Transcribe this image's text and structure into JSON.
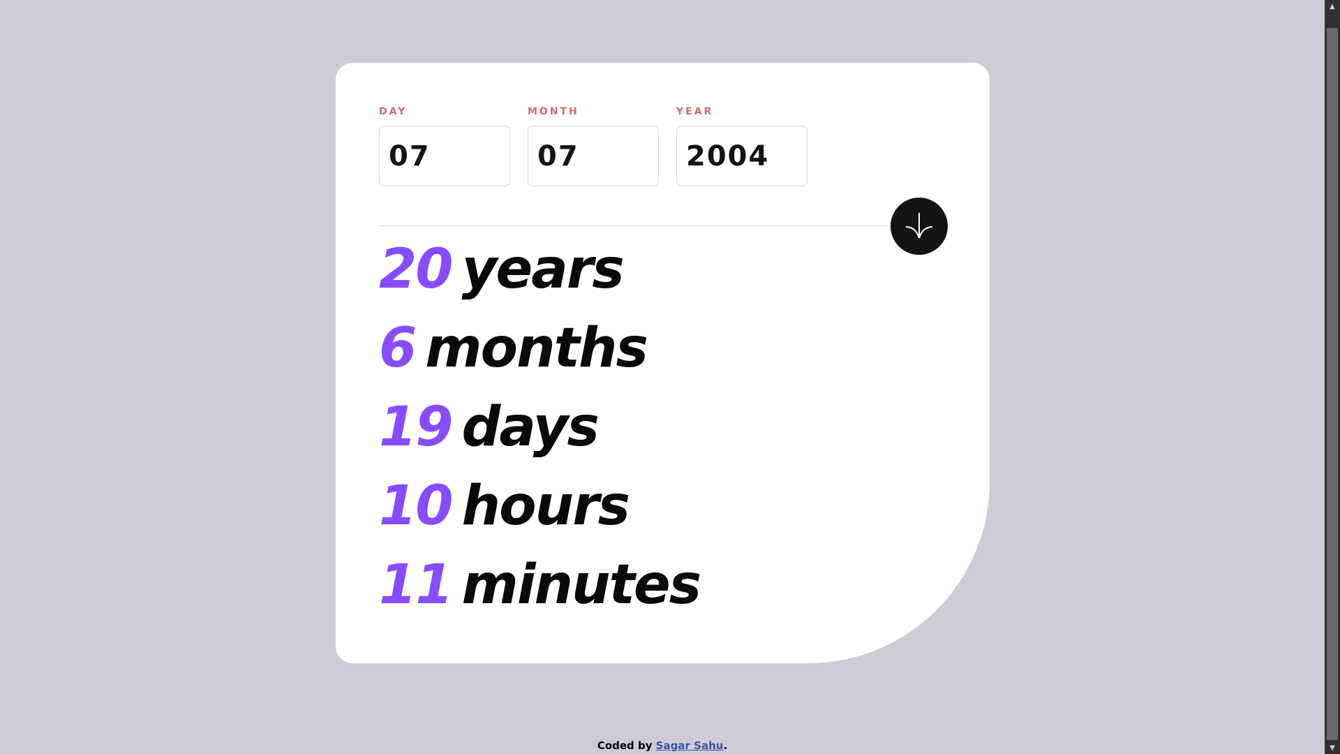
{
  "form": {
    "day": {
      "label": "DAY",
      "value": "07"
    },
    "month": {
      "label": "MONTH",
      "value": "07"
    },
    "year": {
      "label": "YEAR",
      "value": "2004"
    },
    "submit_icon": "arrow-down-icon"
  },
  "results": [
    {
      "value": "20",
      "unit": "years"
    },
    {
      "value": "6",
      "unit": "months"
    },
    {
      "value": "19",
      "unit": "days"
    },
    {
      "value": "10",
      "unit": "hours"
    },
    {
      "value": "11",
      "unit": "minutes"
    }
  ],
  "footer": {
    "prefix": "Coded by",
    "author": "Sagar Sahu",
    "suffix": "."
  },
  "colors": {
    "background": "#cfcbd6",
    "accent": "#854dff",
    "label": "#d26a6a",
    "button": "#141414"
  }
}
